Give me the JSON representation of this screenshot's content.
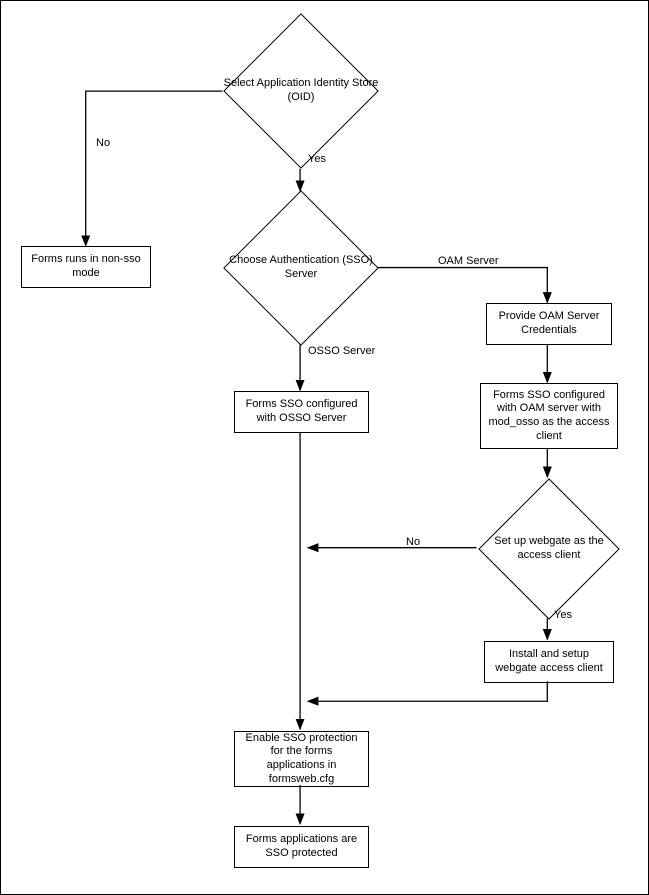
{
  "flowchart": {
    "nodes": {
      "select_identity": {
        "type": "decision",
        "text": "Select Application Identity Store (OID)"
      },
      "choose_auth": {
        "type": "decision",
        "text": "Choose Authentication (SSO) Server"
      },
      "setup_webgate": {
        "type": "decision",
        "text": "Set up webgate as the access client"
      },
      "forms_non_sso": {
        "type": "process",
        "text": "Forms runs in non-sso mode"
      },
      "forms_osso": {
        "type": "process",
        "text": "Forms SSO configured with OSSO Server"
      },
      "provide_oam_creds": {
        "type": "process",
        "text": "Provide OAM Server Credentials"
      },
      "forms_oam_modosso": {
        "type": "process",
        "text": "Forms SSO configured with OAM server with mod_osso as the access client"
      },
      "install_webgate": {
        "type": "process",
        "text": "Install and setup webgate access client"
      },
      "enable_sso": {
        "type": "process",
        "text": "Enable SSO protection for the forms applications in formsweb.cfg"
      },
      "forms_protected": {
        "type": "process",
        "text": "Forms applications are SSO protected"
      }
    },
    "edges": {
      "no1": {
        "from": "select_identity",
        "to": "forms_non_sso",
        "label": "No"
      },
      "yes1": {
        "from": "select_identity",
        "to": "choose_auth",
        "label": "Yes"
      },
      "osso": {
        "from": "choose_auth",
        "to": "forms_osso",
        "label": "OSSO Server"
      },
      "oam": {
        "from": "choose_auth",
        "to": "provide_oam_creds",
        "label": "OAM Server"
      },
      "e1": {
        "from": "provide_oam_creds",
        "to": "forms_oam_modosso",
        "label": ""
      },
      "e2": {
        "from": "forms_oam_modosso",
        "to": "setup_webgate",
        "label": ""
      },
      "no2": {
        "from": "setup_webgate",
        "to": "enable_sso",
        "label": "No"
      },
      "yes2": {
        "from": "setup_webgate",
        "to": "install_webgate",
        "label": "Yes"
      },
      "e3": {
        "from": "install_webgate",
        "to": "enable_sso",
        "label": ""
      },
      "e4": {
        "from": "forms_osso",
        "to": "enable_sso",
        "label": ""
      },
      "e5": {
        "from": "enable_sso",
        "to": "forms_protected",
        "label": ""
      }
    }
  }
}
